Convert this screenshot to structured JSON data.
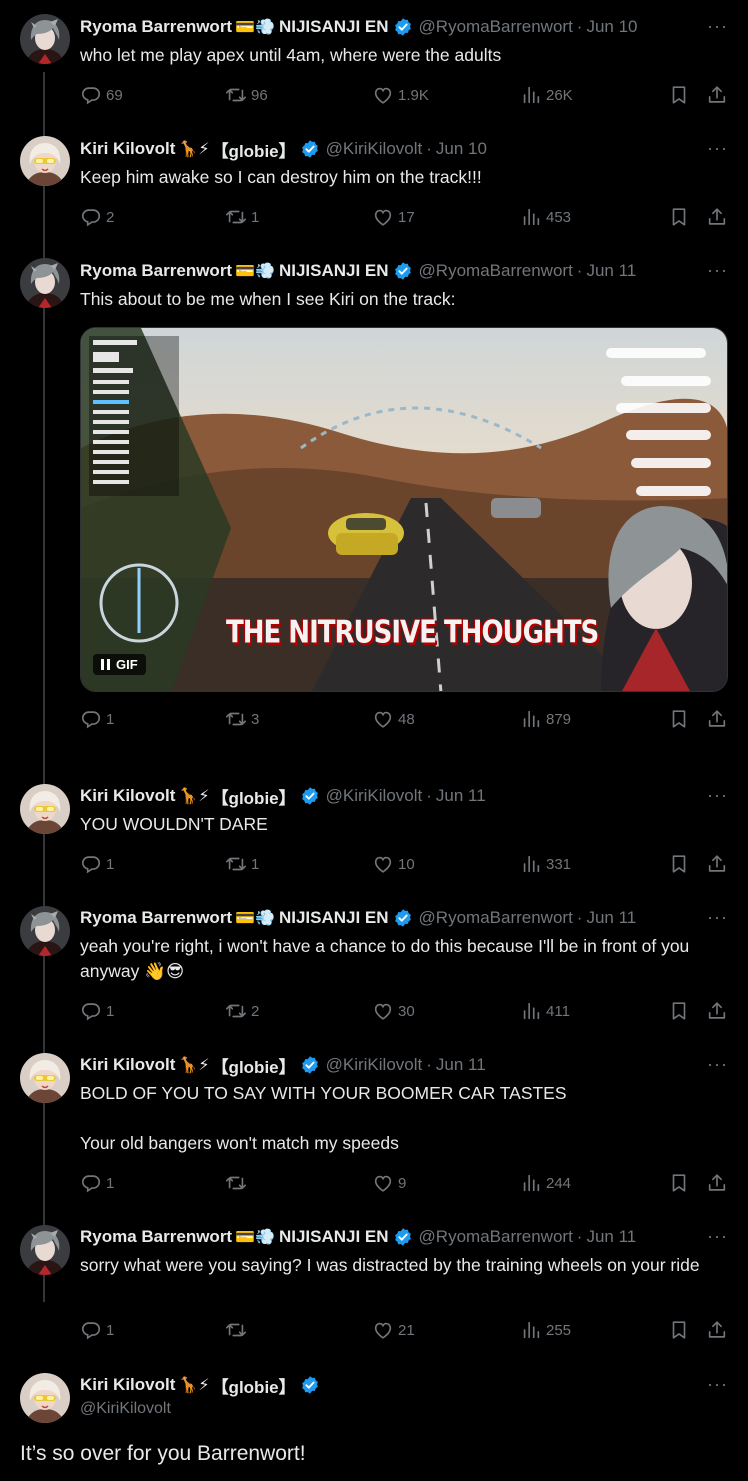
{
  "colors": {
    "background": "#000000",
    "text": "#e7e9ea",
    "muted": "#71767b",
    "verified": "#1d9bf0",
    "thread_line": "#333639"
  },
  "icons": {
    "reply": "reply-icon",
    "retweet": "retweet-icon",
    "like": "heart-icon",
    "views": "views-icon",
    "bookmark": "bookmark-icon",
    "share": "share-icon",
    "more": "more-icon",
    "verified": "verified-badge-icon"
  },
  "ryoma": {
    "name": "Ryoma Barrenwort",
    "emoji": "💳💨",
    "affil": "NIJISANJI EN",
    "handle": "@RyomaBarrenwort"
  },
  "kiri": {
    "name": "Kiri Kilovolt",
    "emoji": "🦒⚡",
    "affil": "【globie】",
    "handle": "@KiriKilovolt"
  },
  "tweets": [
    {
      "date": "Jun 10",
      "text": "who let me play apex until 4am, where were the adults",
      "replies": "69",
      "retweets": "96",
      "likes": "1.9K",
      "views": "26K"
    },
    {
      "date": "Jun 10",
      "text": "Keep him awake so I can destroy him on the track!!!",
      "replies": "2",
      "retweets": "1",
      "likes": "17",
      "views": "453"
    },
    {
      "date": "Jun 11",
      "text": "This about to be me when I see Kiri on the track:",
      "replies": "1",
      "retweets": "3",
      "likes": "48",
      "views": "879",
      "media": {
        "badge": "GIF",
        "caption": "THE NITRUSIVE THOUGHTS"
      }
    },
    {
      "date": "Jun 11",
      "text": "YOU WOULDN'T DARE",
      "replies": "1",
      "retweets": "1",
      "likes": "10",
      "views": "331"
    },
    {
      "date": "Jun 11",
      "text": "yeah you're right, i won't have a chance to do this because I'll be in front of you anyway 👋😎",
      "replies": "1",
      "retweets": "2",
      "likes": "30",
      "views": "411"
    },
    {
      "date": "Jun 11",
      "text": "BOLD OF YOU TO SAY WITH YOUR BOOMER CAR TASTES",
      "text2": "Your old bangers won't match my speeds",
      "replies": "1",
      "retweets": "",
      "likes": "9",
      "views": "244"
    },
    {
      "date": "Jun 11",
      "text": "sorry what were you saying? I was distracted by the training wheels on your ride",
      "replies": "1",
      "retweets": "",
      "likes": "21",
      "views": "255"
    }
  ],
  "focus": {
    "text": "It’s so over for you Barrenwort!"
  },
  "more_label": "···",
  "dot": "·"
}
